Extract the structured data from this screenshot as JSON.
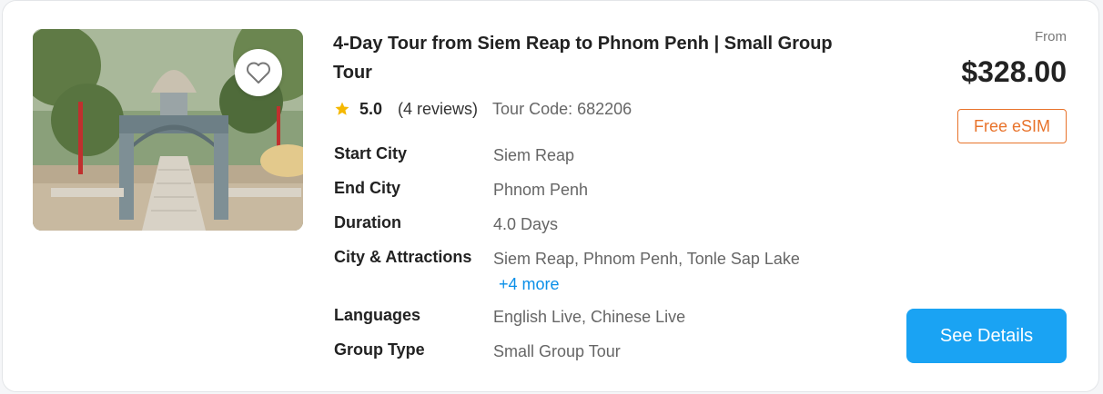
{
  "tour": {
    "title": "4-Day Tour from Siem Reap to Phnom Penh | Small Group Tour",
    "rating": "5.0",
    "reviews": "(4 reviews)",
    "tour_code": "Tour Code: 682206"
  },
  "details": {
    "start_city": {
      "label": "Start City",
      "value": "Siem Reap"
    },
    "end_city": {
      "label": "End City",
      "value": "Phnom Penh"
    },
    "duration": {
      "label": "Duration",
      "value": "4.0 Days"
    },
    "attractions": {
      "label": "City & Attractions",
      "value": "Siem Reap, Phnom Penh, Tonle Sap Lake",
      "more": "+4 more"
    },
    "languages": {
      "label": "Languages",
      "value": "English Live, Chinese Live"
    },
    "group_type": {
      "label": "Group Type",
      "value": "Small Group Tour"
    }
  },
  "pricing": {
    "from_label": "From",
    "price": "$328.00",
    "esim_badge": "Free eSIM",
    "cta": "See Details"
  },
  "icons": {
    "favorite": "heart-outline-icon",
    "rating": "star-icon"
  },
  "colors": {
    "accent_blue": "#1aa3f3",
    "link_blue": "#0a8fe8",
    "esim_orange": "#e8732b",
    "star_gold": "#f5b800"
  }
}
